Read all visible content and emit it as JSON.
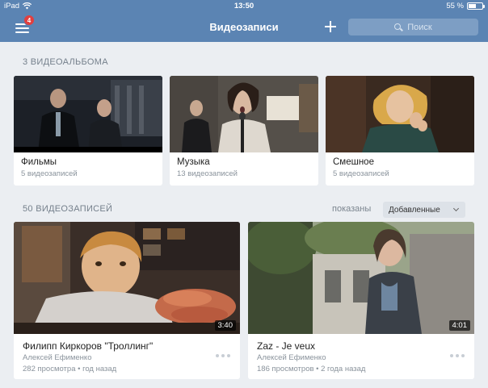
{
  "status_bar": {
    "carrier": "iPad",
    "wifi_icon": "wifi-icon",
    "time": "13:50",
    "battery_percent_text": "55 %",
    "battery_level": 0.55
  },
  "nav": {
    "menu_icon": "hamburger-menu-icon",
    "menu_badge": "4",
    "title": "Видеозаписи",
    "add_icon": "plus-icon",
    "search_placeholder": "Поиск",
    "search_icon": "search-icon"
  },
  "albums_section": {
    "header": "3 ВИДЕОАЛЬБОМА",
    "albums": [
      {
        "title": "Фильмы",
        "count": "5 видеозаписей"
      },
      {
        "title": "Музыка",
        "count": "13 видеозаписей"
      },
      {
        "title": "Смешное",
        "count": "5 видеозаписей"
      }
    ]
  },
  "videos_section": {
    "header": "50 ВИДЕОЗАПИСЕЙ",
    "shown_label": "показаны",
    "sort_value": "Добавленные",
    "videos": [
      {
        "title": "Филипп Киркоров \"Троллинг\"",
        "author": "Алексей Ефименко",
        "stats": "282 просмотра • год назад",
        "duration": "3:40"
      },
      {
        "title": "Zaz - Je veux",
        "author": "Алексей Ефименко",
        "stats": "186 просмотров • 2 года назад",
        "duration": "4:01"
      }
    ]
  },
  "colors": {
    "nav_blue": "#5b84b3",
    "background": "#ebeef2",
    "badge_red": "#e13f3f"
  }
}
